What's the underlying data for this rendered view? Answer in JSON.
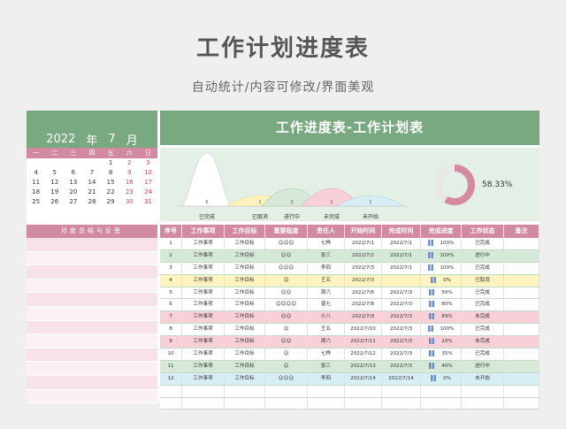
{
  "header": {
    "title": "工作计划进度表",
    "subtitle": "自动统计/内容可修改/界面美观"
  },
  "calendar": {
    "year": "2022",
    "year_unit": "年",
    "month": "7",
    "month_unit": "月",
    "weekdays": [
      "一",
      "二",
      "三",
      "四",
      "五",
      "六",
      "日"
    ],
    "days": [
      "",
      "",
      "",
      "",
      "1",
      "2",
      "3",
      "4",
      "5",
      "6",
      "7",
      "8",
      "9",
      "10",
      "11",
      "12",
      "13",
      "14",
      "15",
      "16",
      "17",
      "18",
      "19",
      "20",
      "21",
      "22",
      "23",
      "24",
      "25",
      "26",
      "27",
      "28",
      "29",
      "30",
      "31"
    ]
  },
  "summary": {
    "title": "月度总结与反思"
  },
  "main": {
    "title": "工作进度表-工作计划表"
  },
  "stats": [
    {
      "label": "已完成",
      "value": "6",
      "color": "#ffffff"
    },
    {
      "label": "已取消",
      "value": "1",
      "color": "#fff3bf"
    },
    {
      "label": "进行中",
      "value": "2",
      "color": "#d6e8d8"
    },
    {
      "label": "未完成",
      "value": "2",
      "color": "#f8d0d8"
    },
    {
      "label": "未开始",
      "value": "1",
      "color": "#d8eef5"
    }
  ],
  "progress": {
    "percent": "58.33%",
    "value": 0.5833
  },
  "table": {
    "headers": [
      "序号",
      "工作事项",
      "工作目标",
      "重要程度",
      "责任人",
      "开始时间",
      "完成时间",
      "完成进度",
      "工作状态",
      "备注"
    ],
    "rows": [
      [
        "1",
        "工作事项",
        "工作目标",
        "☺☺☺",
        "七桦",
        "2022/7/1",
        "2022/7/1",
        "100%",
        "已完成",
        ""
      ],
      [
        "2",
        "工作事项",
        "工作目标",
        "☺☺",
        "张三",
        "2022/7/2",
        "2022/7/1",
        "100%",
        "进行中",
        ""
      ],
      [
        "3",
        "工作事项",
        "工作目标",
        "☺☺☺",
        "李四",
        "2022/7/3",
        "2022/7/1",
        "100%",
        "已完成",
        ""
      ],
      [
        "4",
        "工作事项",
        "工作目标",
        "☺",
        "王五",
        "2022/7/3",
        "",
        "0%",
        "已取消",
        ""
      ],
      [
        "5",
        "工作事项",
        "工作目标",
        "☺☺",
        "周六",
        "2022/7/6",
        "2022/7/3",
        "50%",
        "已完成",
        ""
      ],
      [
        "6",
        "工作事项",
        "工作目标",
        "☺☺☺☺",
        "晋七",
        "2022/7/8",
        "2022/7/3",
        "80%",
        "已完成",
        ""
      ],
      [
        "7",
        "工作事项",
        "工作目标",
        "☺☺",
        "小八",
        "2022/7/9",
        "2022/7/3",
        "89%",
        "未完成",
        ""
      ],
      [
        "8",
        "工作事项",
        "工作目标",
        "☺",
        "王五",
        "2022/7/10",
        "2022/7/3",
        "100%",
        "已完成",
        ""
      ],
      [
        "9",
        "工作事项",
        "工作目标",
        "☺☺",
        "周六",
        "2022/7/11",
        "2022/7/3",
        "20%",
        "未完成",
        ""
      ],
      [
        "10",
        "工作事项",
        "工作目标",
        "☺",
        "七桦",
        "2022/7/12",
        "2022/7/3",
        "35%",
        "已完成",
        ""
      ],
      [
        "11",
        "工作事项",
        "工作目标",
        "☺",
        "张三",
        "2022/7/13",
        "2022/7/3",
        "40%",
        "进行中",
        ""
      ],
      [
        "12",
        "工作事项",
        "工作目标",
        "☺☺☺",
        "李四",
        "2022/7/14",
        "2022/7/14",
        "0%",
        "未开始",
        ""
      ],
      [
        "",
        "",
        "",
        "",
        "",
        "",
        "",
        "",
        "",
        ""
      ],
      [
        "",
        "",
        "",
        "",
        "",
        "",
        "",
        "",
        "",
        ""
      ]
    ],
    "row_colors": {
      "已完成": "#ffffff",
      "进行中": "#d6e8d8",
      "已取消": "#fff3bf",
      "未完成": "#f8d0d8",
      "未开始": "#d8eef5",
      "": "#ffffff"
    }
  }
}
